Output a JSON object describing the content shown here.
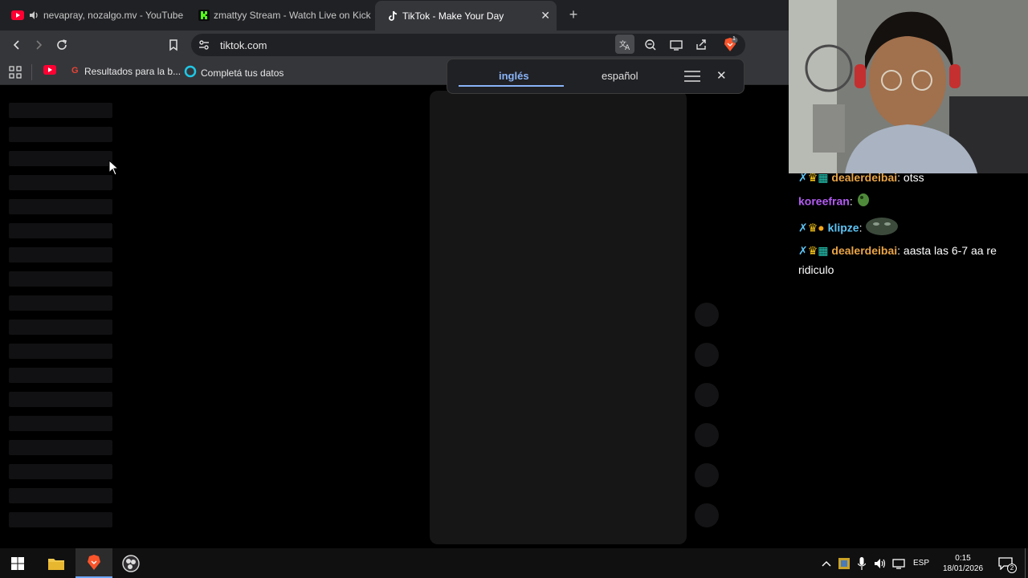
{
  "browser": {
    "tabs": [
      {
        "title": "nevapray, nozalgo.mv - YouTube",
        "favicon": "youtube-icon",
        "active": false
      },
      {
        "title": "zmattyy Stream - Watch Live on Kick",
        "favicon": "kick-icon",
        "active": false
      },
      {
        "title": "TikTok - Make Your Day",
        "favicon": "tiktok-icon",
        "active": true
      }
    ],
    "new_tab": "+",
    "close_tab": "✕",
    "url": "tiktok.com",
    "bookmarks": [
      {
        "label": "",
        "icon": "youtube-icon"
      },
      {
        "label": "Resultados para la b...",
        "icon": "google-icon"
      },
      {
        "label": "Completá tus datos",
        "icon": "circle-logo-icon"
      }
    ],
    "shields_badge": "1"
  },
  "translate_popup": {
    "source_language": "inglés",
    "target_language": "español",
    "close": "✕"
  },
  "chat": {
    "messages": [
      {
        "user": "dealerdeibai",
        "user_color": "#e9a447",
        "text": "otss",
        "badges": [
          "sword-icon",
          "crown-icon",
          "sub-badge-icon"
        ]
      },
      {
        "user": "koreefran",
        "user_color": "#b35cf2",
        "text": "",
        "badges": [],
        "emote": "frog-emote"
      },
      {
        "user": "klipze",
        "user_color": "#5ec4f5",
        "text": "",
        "badges": [
          "sword-icon",
          "crown-icon",
          "coin-badge-icon"
        ],
        "emote": "creature-emote"
      },
      {
        "user": "dealerdeibai",
        "user_color": "#e9a447",
        "text": "aasta las 6-7 aa re",
        "continuation": "ridiculo",
        "badges": [
          "sword-icon",
          "crown-icon",
          "sub-badge-icon"
        ]
      }
    ]
  },
  "taskbar": {
    "language": "ESP",
    "time": "0:15",
    "date": "18/01/2026",
    "notification_count": "2"
  }
}
